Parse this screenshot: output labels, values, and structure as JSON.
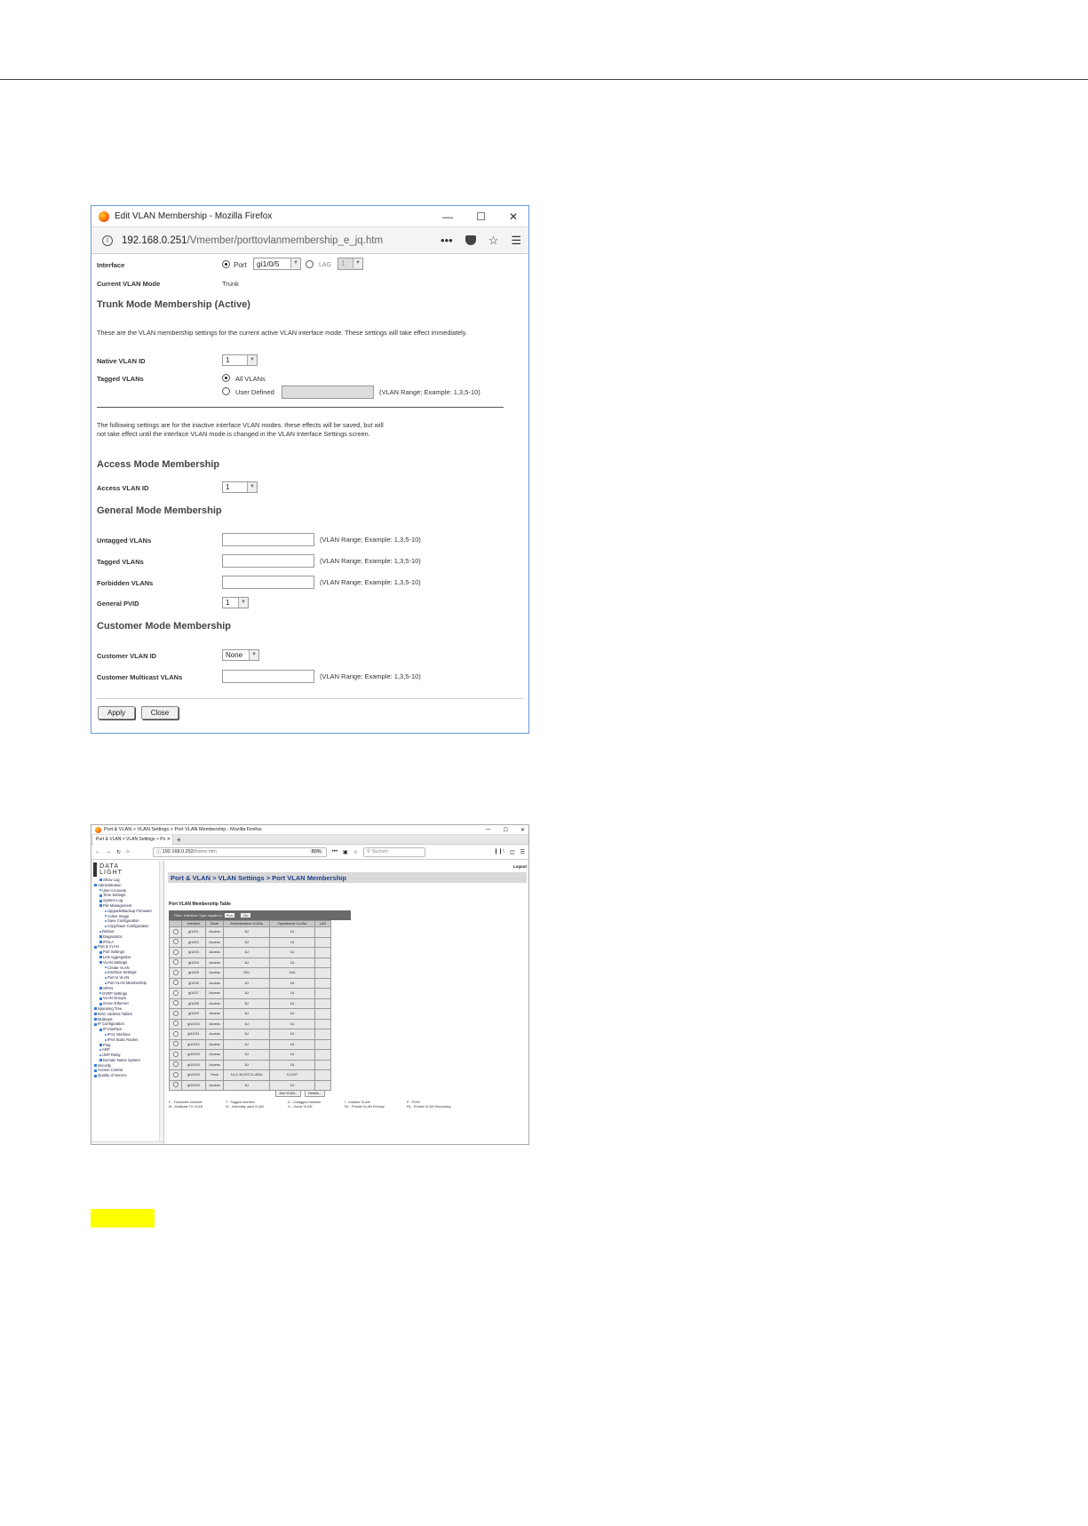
{
  "window1": {
    "title": "Edit VLAN Membership - Mozilla Firefox",
    "url_host": "192.168.0.251",
    "url_path": "/Vmember/porttovlanmembership_e_jq.htm",
    "interface_label": "Interface",
    "port_label": "Port",
    "port_value": "gi1/0/5",
    "lag_label": "LAG",
    "lag_value": "1",
    "current_mode_label": "Current VLAN Mode",
    "current_mode_value": "Trunk",
    "trunk_heading": "Trunk Mode Membership (Active)",
    "trunk_desc": "These are the VLAN membership settings for the current active VLAN interface mode. These settings will take effect immediately.",
    "native_vlan_label": "Native VLAN ID",
    "native_vlan_value": "1",
    "tagged_vlans_label": "Tagged VLANs",
    "all_vlans_label": "All VLANs",
    "user_defined_label": "User Defined",
    "vlan_range_hint": "(VLAN Range; Example: 1,3,5-10)",
    "inactive_desc_1": "The following settings are for the inactive interface VLAN modes. these effects will be saved, but will",
    "inactive_desc_2": "not take effect until the interface VLAN mode is changed in the VLAN Interface Settings screen.",
    "access_heading": "Access Mode Membership",
    "access_vlan_label": "Access VLAN ID",
    "access_vlan_value": "1",
    "general_heading": "General Mode Membership",
    "untagged_label": "Untagged VLANs",
    "tagged_label": "Tagged VLANs",
    "forbidden_label": "Forbidden VLANs",
    "pvid_label": "General PVID",
    "pvid_value": "1",
    "customer_heading": "Customer Mode Membership",
    "customer_vlan_label": "Customer VLAN ID",
    "customer_vlan_value": "None",
    "customer_mc_label": "Customer Multicast VLANs",
    "apply_label": "Apply",
    "close_label": "Close"
  },
  "window2": {
    "title": "Port & VLAN > VLAN Settings > Port VLAN Membership - Mozilla Firefox",
    "tab_label": "Port & VLAN > VLAN Settings > Po",
    "url_host": "192.168.0.252",
    "url_path": "/home.htm",
    "zoom": "80%",
    "search_placeholder": "Suchen",
    "logo_line1": "DATA",
    "logo_line2": "LIGHT",
    "logout": "Logout",
    "breadcrumb": "Port & VLAN > VLAN Settings > Port VLAN Membership",
    "table_title": "Port VLAN Membership Table",
    "filter_label": "Filter: Interface Type equals to",
    "filter_value": "Port",
    "go_label": "Go",
    "headers": [
      "",
      "Interface",
      "Mode",
      "Administrative VLANs",
      "Operational VLANs",
      "LAG"
    ],
    "rows": [
      [
        "gi1/0/1",
        "Access",
        "1U",
        "1U",
        ""
      ],
      [
        "gi1/0/2",
        "Access",
        "1U",
        "1U",
        ""
      ],
      [
        "gi1/0/3",
        "Access",
        "1U",
        "1U",
        ""
      ],
      [
        "gi1/0/4",
        "Access",
        "1U",
        "1U",
        ""
      ],
      [
        "gi1/0/5",
        "Access",
        "20U",
        "20U",
        ""
      ],
      [
        "gi1/0/6",
        "Access",
        "1U",
        "1U",
        ""
      ],
      [
        "gi1/0/7",
        "Access",
        "1U",
        "1U",
        ""
      ],
      [
        "gi1/0/8",
        "Access",
        "1U",
        "1U",
        ""
      ],
      [
        "gi1/0/9",
        "Access",
        "1U",
        "1U",
        ""
      ],
      [
        "gi1/0/10",
        "Access",
        "1U",
        "1U",
        ""
      ],
      [
        "gi1/0/11",
        "Access",
        "1U",
        "1U",
        ""
      ],
      [
        "gi1/0/12",
        "Access",
        "1U",
        "1U",
        ""
      ],
      [
        "gi1/0/13",
        "Access",
        "1U",
        "1U",
        ""
      ],
      [
        "gi1/0/14",
        "Access",
        "1U",
        "1U",
        ""
      ],
      [
        "gi1/0/15",
        "Trunk",
        "1U,2-19,20T,21-4094",
        "1U,20T",
        ""
      ],
      [
        "gi1/0/16",
        "Access",
        "1U",
        "1U",
        ""
      ]
    ],
    "join_label": "Join VLAN...",
    "details_label": "Details...",
    "legend": [
      "F - Forbidden member",
      "T - Tagged member",
      "U - Untagged member",
      "I - Inactive VLAN",
      "P - PVID",
      "M - Multicast TV VLAN",
      "Sr - Internally used VLAN",
      "G - Guest VLAN",
      "Pp - Private VLAN Primary",
      "Ps - Private VLAN Secondary"
    ],
    "sidebar": [
      {
        "t": "Show Log",
        "k": "sq",
        "i": 1
      },
      {
        "t": "Administration",
        "k": "sq",
        "i": 0
      },
      {
        "t": "User Accounts",
        "k": "dot",
        "i": 1
      },
      {
        "t": "Time Settings",
        "k": "sq",
        "i": 1
      },
      {
        "t": "System Log",
        "k": "sq",
        "i": 1
      },
      {
        "t": "File Management",
        "k": "sq",
        "i": 1
      },
      {
        "t": "Upgrade/Backup Firmware",
        "k": "dot",
        "i": 2
      },
      {
        "t": "Active Image",
        "k": "dot",
        "i": 2
      },
      {
        "t": "Save Configuration",
        "k": "dot",
        "i": 2
      },
      {
        "t": "Copy/Save Configuration",
        "k": "dot",
        "i": 2
      },
      {
        "t": "Reboot",
        "k": "dot",
        "i": 1
      },
      {
        "t": "Diagnostics",
        "k": "sq",
        "i": 1
      },
      {
        "t": "IPSLA",
        "k": "sq",
        "i": 1
      },
      {
        "t": "Port & VLAN",
        "k": "sq",
        "i": 0
      },
      {
        "t": "Port Settings",
        "k": "sq",
        "i": 1
      },
      {
        "t": "Link Aggregation",
        "k": "sq",
        "i": 1
      },
      {
        "t": "VLAN Settings",
        "k": "sq",
        "i": 1
      },
      {
        "t": "Create VLAN",
        "k": "dot",
        "i": 2
      },
      {
        "t": "Interface Settings",
        "k": "dot",
        "i": 2
      },
      {
        "t": "Port to VLAN",
        "k": "dot",
        "i": 2
      },
      {
        "t": "Port VLAN Membership",
        "k": "dot",
        "i": 2
      },
      {
        "t": "SPAN",
        "k": "sq",
        "i": 1
      },
      {
        "t": "GVRP Settings",
        "k": "dot",
        "i": 1
      },
      {
        "t": "VLAN Groups",
        "k": "sq",
        "i": 1
      },
      {
        "t": "Green Ethernet",
        "k": "sq",
        "i": 1
      },
      {
        "t": "Spanning Tree",
        "k": "sq",
        "i": 0
      },
      {
        "t": "MAC Address Tables",
        "k": "sq",
        "i": 0
      },
      {
        "t": "Multicast",
        "k": "sq",
        "i": 0
      },
      {
        "t": "IP Configuration",
        "k": "sq",
        "i": 0
      },
      {
        "t": "IP Interface",
        "k": "sq",
        "i": 1
      },
      {
        "t": "IPv4 Interface",
        "k": "dot",
        "i": 2
      },
      {
        "t": "IPv4 Static Routes",
        "k": "dot",
        "i": 2
      },
      {
        "t": "Ping",
        "k": "sq",
        "i": 1
      },
      {
        "t": "ARP",
        "k": "dot",
        "i": 1
      },
      {
        "t": "UDP Relay",
        "k": "dot",
        "i": 1
      },
      {
        "t": "Domain Name System",
        "k": "sq",
        "i": 1
      },
      {
        "t": "Security",
        "k": "sq",
        "i": 0
      },
      {
        "t": "Access Control",
        "k": "sq",
        "i": 0
      },
      {
        "t": "Quality of Service",
        "k": "sq",
        "i": 0
      }
    ]
  }
}
